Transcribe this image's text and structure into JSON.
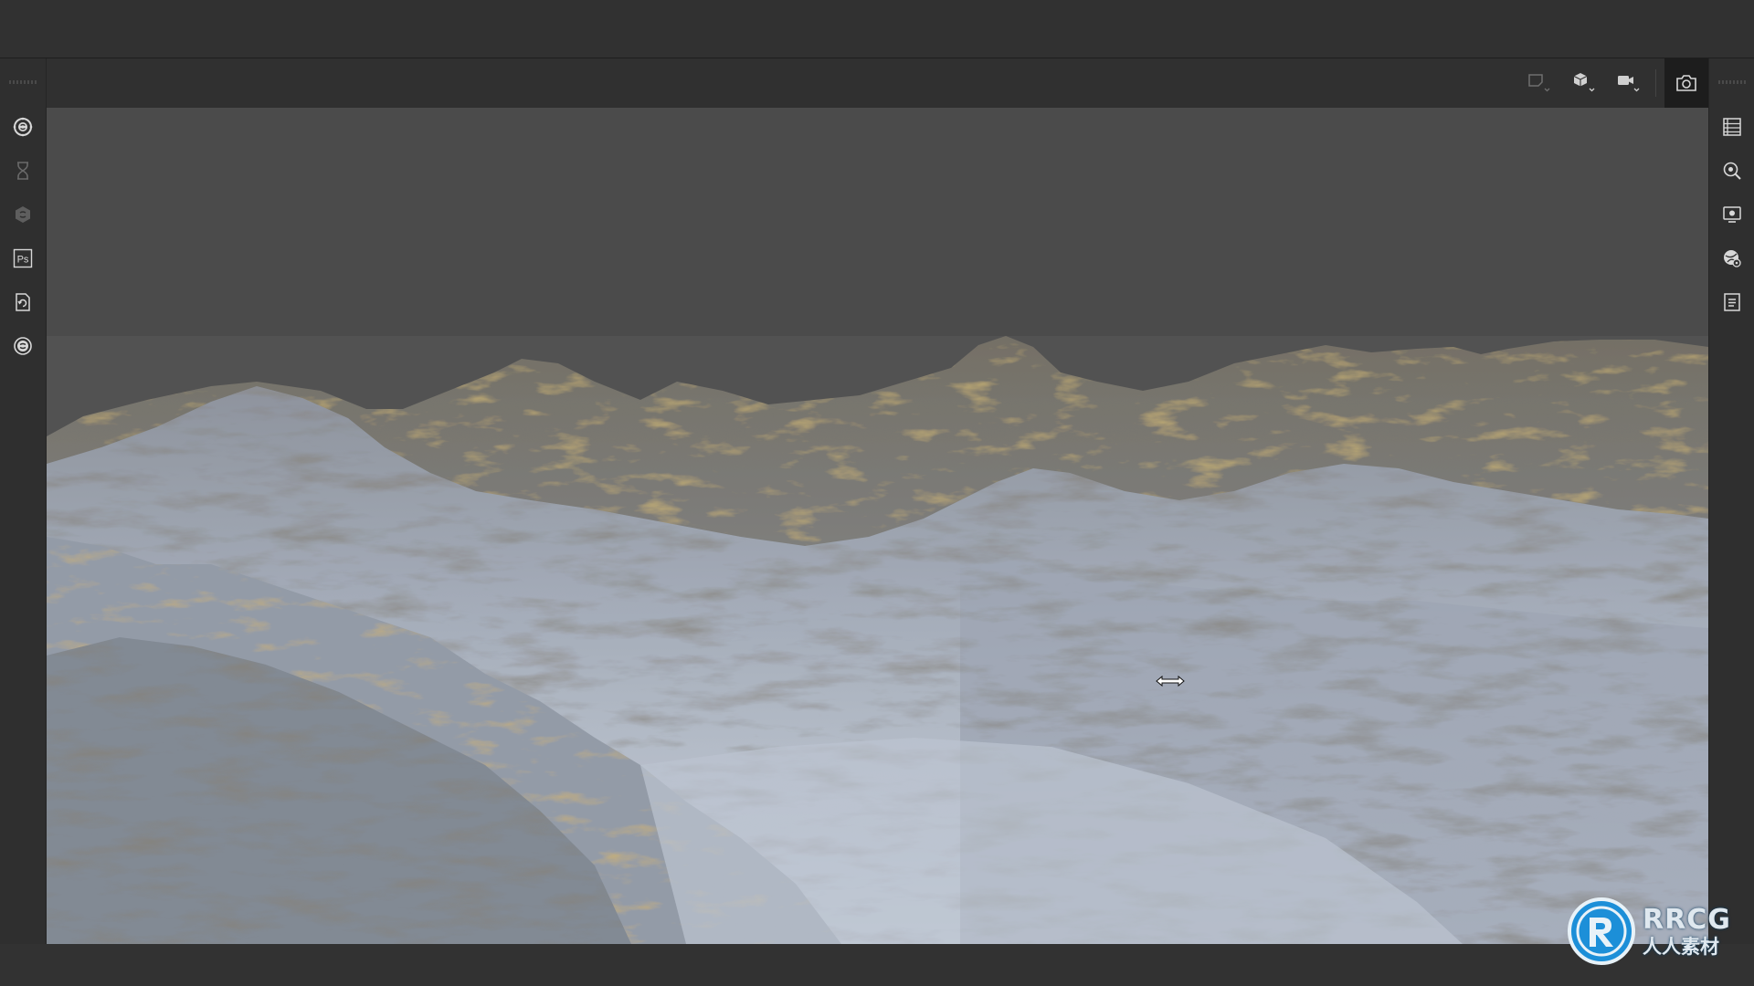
{
  "left_toolbar": {
    "tools": [
      {
        "icon": "substance-designer-icon"
      },
      {
        "icon": "hourglass-icon"
      },
      {
        "icon": "substance-painter-icon"
      },
      {
        "icon": "photoshop-icon",
        "label": "Ps"
      },
      {
        "icon": "refresh-document-icon"
      },
      {
        "icon": "substance-sampler-icon"
      }
    ]
  },
  "viewport_toolbar": {
    "buttons": [
      {
        "icon": "frame-display-icon"
      },
      {
        "icon": "cube-view-icon"
      },
      {
        "icon": "camera-icon"
      }
    ],
    "snapshot_icon": "snapshot-camera-icon"
  },
  "right_toolbar": {
    "tools": [
      {
        "icon": "list-panel-icon"
      },
      {
        "icon": "zoom-settings-icon"
      },
      {
        "icon": "display-settings-icon"
      },
      {
        "icon": "environment-settings-icon"
      },
      {
        "icon": "notes-icon"
      }
    ]
  },
  "viewport": {
    "background_color": "#4b4b4b",
    "content": "terrain-render"
  },
  "watermark": {
    "brand": "RRCG",
    "subtitle": "人人素材"
  }
}
